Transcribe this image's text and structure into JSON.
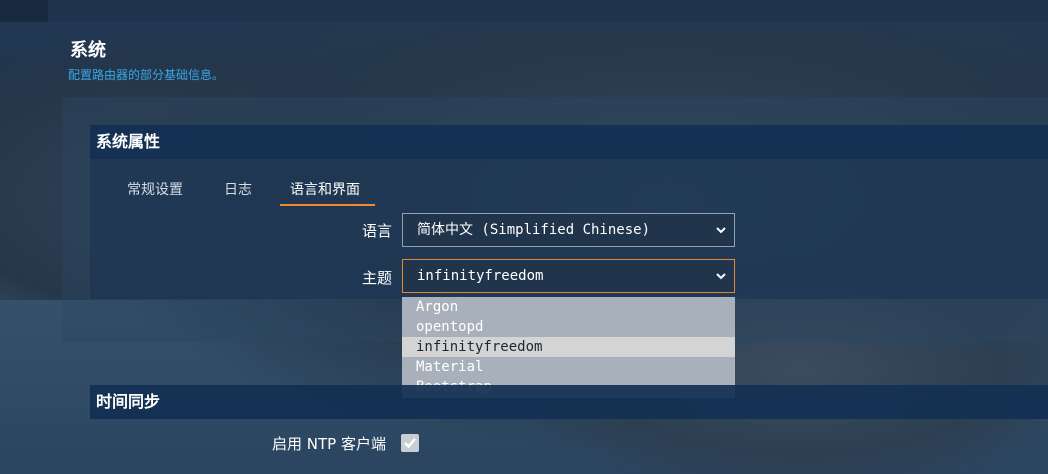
{
  "page": {
    "title": "系统",
    "description": "配置路由器的部分基础信息。"
  },
  "section_system": {
    "title": "系统属性",
    "tabs": [
      {
        "label": "常规设置",
        "active": false
      },
      {
        "label": "日志",
        "active": false
      },
      {
        "label": "语言和界面",
        "active": true
      }
    ],
    "language": {
      "label": "语言",
      "value": "简体中文 (Simplified Chinese)"
    },
    "theme": {
      "label": "主题",
      "value": "infinityfreedom",
      "options": [
        "Argon",
        "opentopd",
        "infinityfreedom",
        "Material",
        "Bootstrap"
      ],
      "selected": "infinityfreedom"
    }
  },
  "section_time": {
    "title": "时间同步",
    "ntp_label": "启用 NTP 客户端",
    "ntp_enabled": true
  },
  "colors": {
    "accent": "#f28a2e",
    "link": "#38a8e8",
    "header_bg": "#12305a"
  },
  "icons": {
    "select_arrow": "chevron-down-icon",
    "checkbox": "checkmark-icon"
  }
}
